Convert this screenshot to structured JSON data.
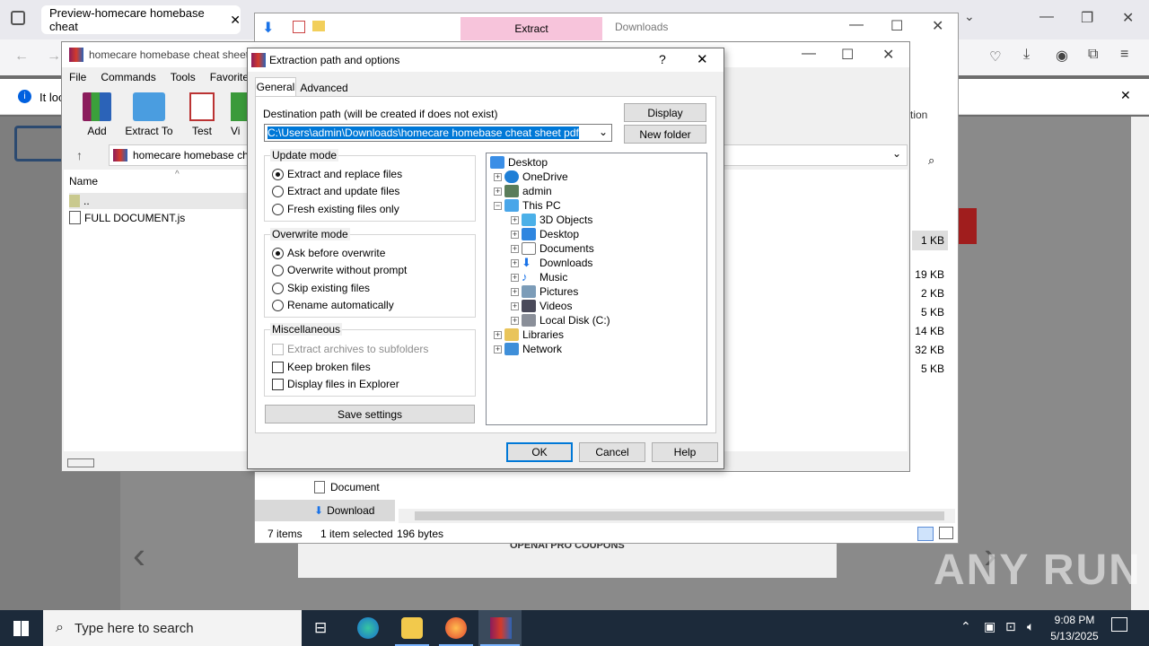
{
  "browser": {
    "tab_title": "Preview-homecare homebase cheat",
    "info_prefix": "It loo",
    "sidebar_label": "tion"
  },
  "explorer": {
    "ribbon_tab_extract": "Extract",
    "ribbon_tab_downloads": "Downloads",
    "nav_documents": "Document",
    "nav_downloads": "Download",
    "status_items": "7 items",
    "status_selected": "1 item selected",
    "status_size": "196 bytes",
    "sizes": [
      "1 KB",
      "19 KB",
      "2 KB",
      "5 KB",
      "14 KB",
      "32 KB",
      "5 KB"
    ]
  },
  "winrar": {
    "title": "homecare homebase cheat sheet",
    "menu": [
      "File",
      "Commands",
      "Tools",
      "Favorites"
    ],
    "toolbar": [
      "Add",
      "Extract To",
      "Test",
      "Vi"
    ],
    "address": "homecare homebase ch",
    "column_name": "Name",
    "files": [
      "..",
      "FULL DOCUMENT.js"
    ]
  },
  "dialog": {
    "title": "Extraction path and options",
    "help_glyph": "?",
    "close_glyph": "✕",
    "tabs": [
      "General",
      "Advanced"
    ],
    "dest_label": "Destination path (will be created if does not exist)",
    "dest_value": "C:\\Users\\admin\\Downloads\\homecare homebase cheat sheet pdf",
    "display_button": "Display",
    "new_folder_button": "New folder",
    "update_mode": {
      "title": "Update mode",
      "options": [
        "Extract and replace files",
        "Extract and update files",
        "Fresh existing files only"
      ],
      "selected": 0
    },
    "overwrite_mode": {
      "title": "Overwrite mode",
      "options": [
        "Ask before overwrite",
        "Overwrite without prompt",
        "Skip existing files",
        "Rename automatically"
      ],
      "selected": 0
    },
    "misc": {
      "title": "Miscellaneous",
      "options": [
        "Extract archives to subfolders",
        "Keep broken files",
        "Display files in Explorer"
      ]
    },
    "save_settings": "Save settings",
    "tree": [
      "Desktop",
      "OneDrive",
      "admin",
      "This PC",
      "3D Objects",
      "Desktop",
      "Documents",
      "Downloads",
      "Music",
      "Pictures",
      "Videos",
      "Local Disk (C:)",
      "Libraries",
      "Network"
    ],
    "ok": "OK",
    "cancel": "Cancel",
    "help": "Help"
  },
  "page_footer": "OPENAI PRO COUPONS",
  "watermark": "ANY RUN",
  "taskbar": {
    "search_placeholder": "Type here to search",
    "time": "9:08 PM",
    "date": "5/13/2025"
  }
}
